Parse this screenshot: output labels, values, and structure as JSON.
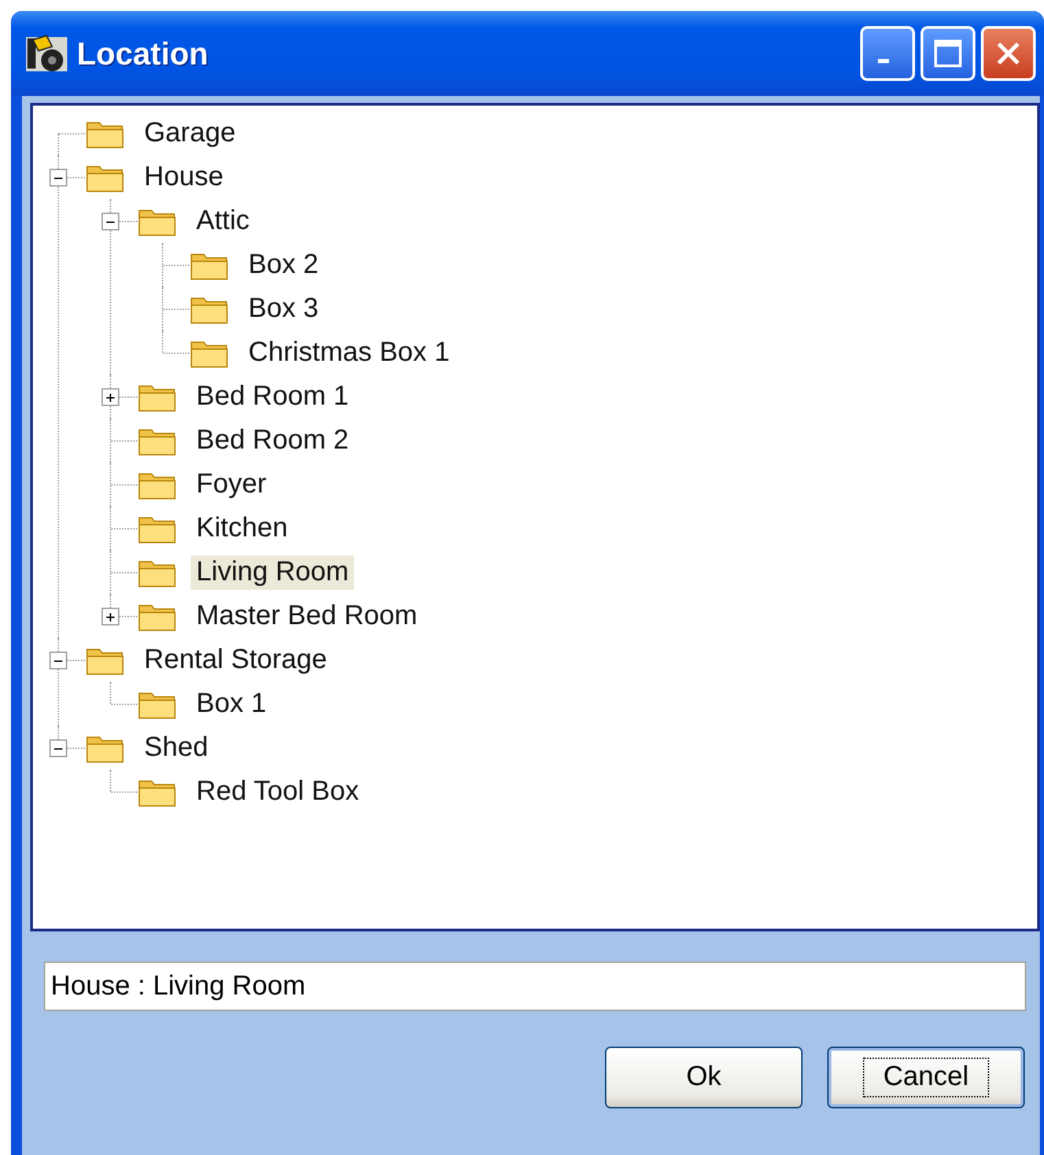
{
  "window": {
    "title": "Location"
  },
  "tree": [
    {
      "label": "Garage",
      "selected": false
    },
    {
      "label": "House",
      "selected": false,
      "expanded": true,
      "children": [
        {
          "label": "Attic",
          "selected": false,
          "expanded": true,
          "children": [
            {
              "label": "Box 2",
              "selected": false
            },
            {
              "label": "Box 3",
              "selected": false
            },
            {
              "label": "Christmas Box 1",
              "selected": false
            }
          ]
        },
        {
          "label": "Bed Room 1",
          "selected": false,
          "expanded": false
        },
        {
          "label": "Bed Room 2",
          "selected": false
        },
        {
          "label": "Foyer",
          "selected": false
        },
        {
          "label": "Kitchen",
          "selected": false
        },
        {
          "label": "Living Room",
          "selected": true
        },
        {
          "label": "Master Bed Room",
          "selected": false,
          "expanded": false
        }
      ]
    },
    {
      "label": "Rental Storage",
      "selected": false,
      "expanded": true,
      "children": [
        {
          "label": "Box 1",
          "selected": false
        }
      ]
    },
    {
      "label": "Shed",
      "selected": false,
      "expanded": true,
      "children": [
        {
          "label": "Red Tool Box",
          "selected": false
        }
      ]
    }
  ],
  "path_field": {
    "value": "House : Living Room"
  },
  "buttons": [
    {
      "label": "Ok",
      "focused": false
    },
    {
      "label": "Cancel",
      "focused": true
    }
  ]
}
